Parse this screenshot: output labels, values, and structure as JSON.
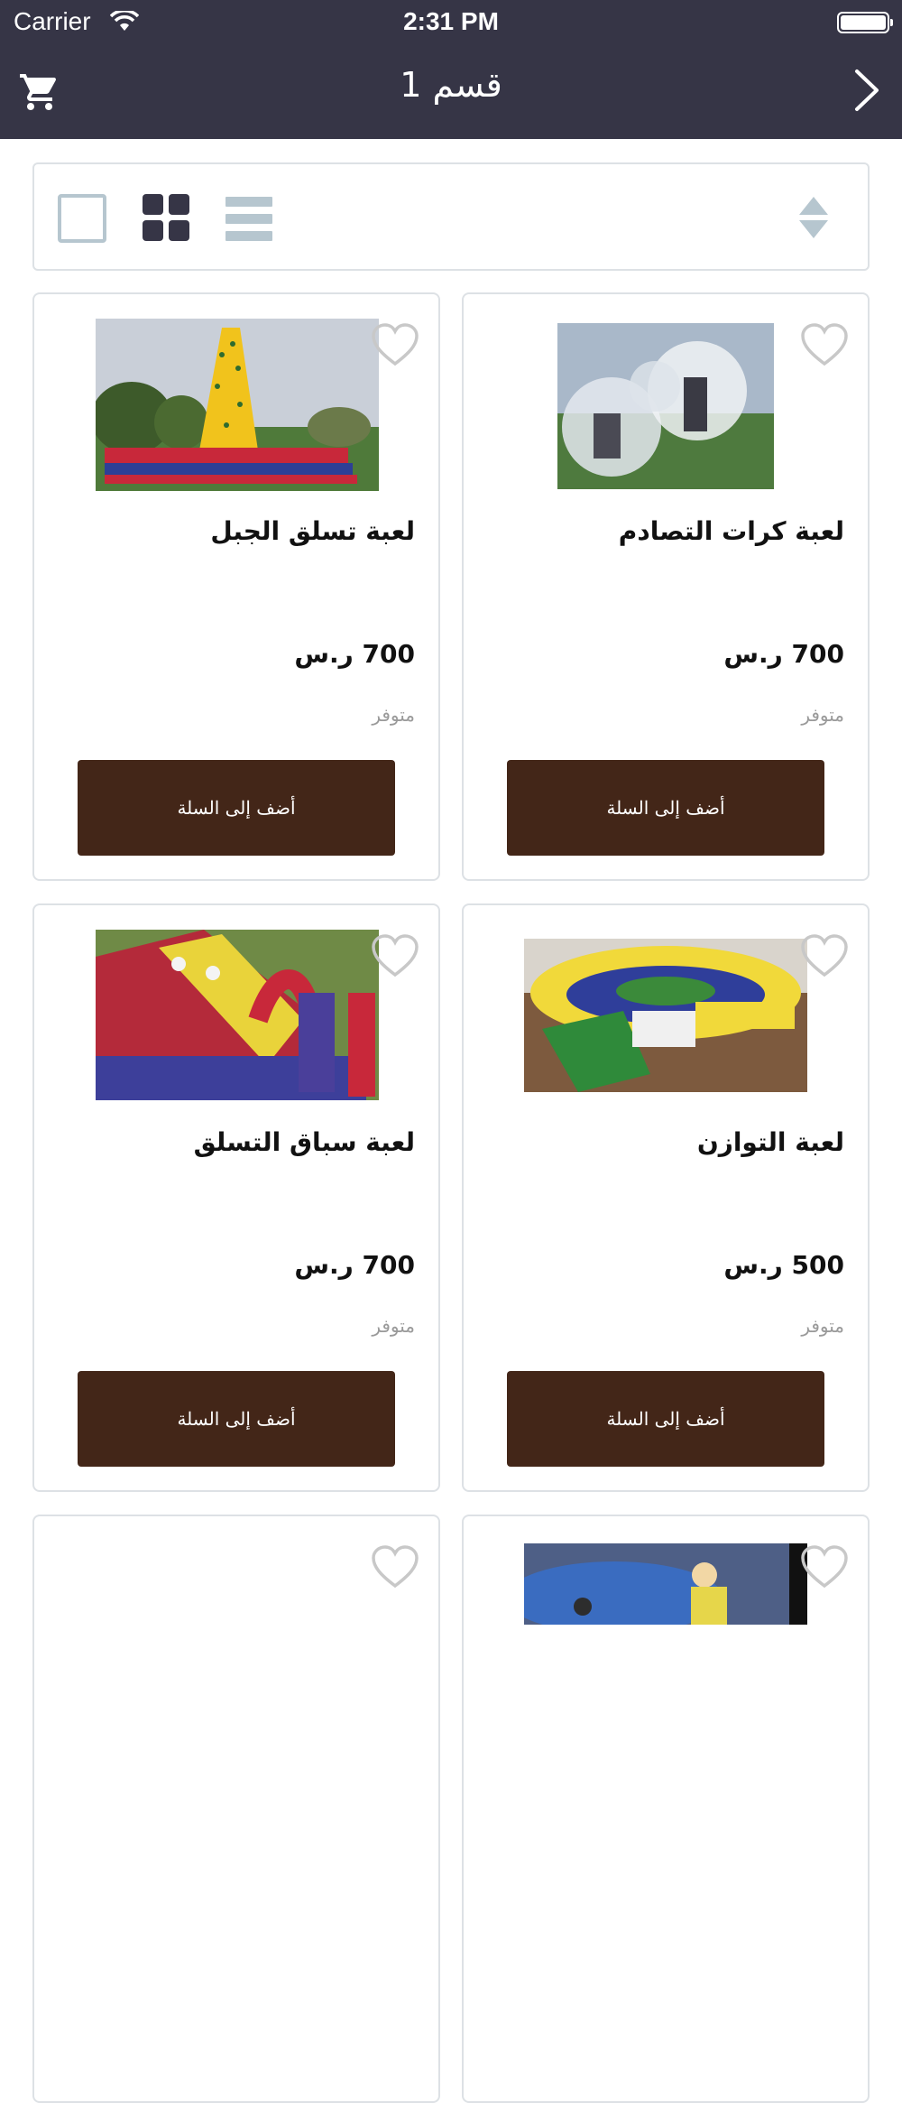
{
  "status_bar": {
    "carrier": "Carrier",
    "time": "2:31 PM"
  },
  "nav": {
    "title": "قسم 1",
    "cart_icon": "cart-icon",
    "back_icon": "chevron-right-icon"
  },
  "toolbar": {
    "single_view_icon": "single-view-icon",
    "grid_view_icon": "grid-view-icon",
    "list_view_icon": "list-view-icon",
    "sort_icon": "sort-icon"
  },
  "colors": {
    "header": "#363546",
    "button": "#432618",
    "border": "#dde1e5",
    "muted": "#b6c6cf"
  },
  "products": [
    {
      "name": "لعبة تسلق الجبل",
      "price": "700 ر.س",
      "stock": "متوفر",
      "button": "أضف إلى السلة"
    },
    {
      "name": "لعبة كرات التصادم",
      "price": "700 ر.س",
      "stock": "متوفر",
      "button": "أضف إلى السلة"
    },
    {
      "name": "لعبة سباق التسلق",
      "price": "700 ر.س",
      "stock": "متوفر",
      "button": "أضف إلى السلة"
    },
    {
      "name": "لعبة التوازن",
      "price": "500 ر.س",
      "stock": "متوفر",
      "button": "أضف إلى السلة"
    },
    {
      "name": "",
      "price": "",
      "stock": "",
      "button": ""
    },
    {
      "name": "",
      "price": "",
      "stock": "",
      "button": ""
    }
  ]
}
